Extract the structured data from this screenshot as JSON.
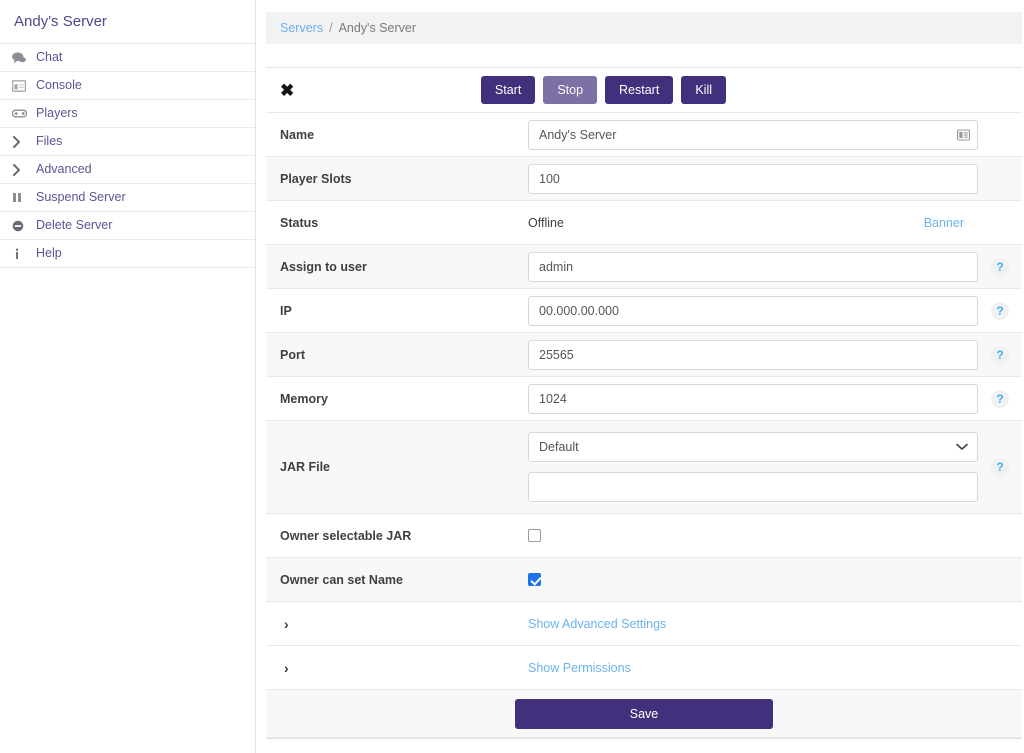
{
  "sidebar": {
    "title": "Andy's Server",
    "items": [
      {
        "label": "Chat",
        "icon": "comments-icon"
      },
      {
        "label": "Console",
        "icon": "console-window-icon"
      },
      {
        "label": "Players",
        "icon": "gamepad-icon"
      },
      {
        "label": "Files",
        "icon": "chevron-right-icon"
      },
      {
        "label": "Advanced",
        "icon": "chevron-right-icon"
      },
      {
        "label": "Suspend Server",
        "icon": "pause-icon"
      },
      {
        "label": "Delete Server",
        "icon": "minus-circle-icon"
      },
      {
        "label": "Help",
        "icon": "info-icon"
      }
    ]
  },
  "breadcrumb": {
    "root": "Servers",
    "separator": "/",
    "current": "Andy's Server"
  },
  "actions": {
    "close_glyph": "✖",
    "buttons": [
      {
        "label": "Start",
        "style": "primary"
      },
      {
        "label": "Stop",
        "style": "muted"
      },
      {
        "label": "Restart",
        "style": "primary"
      },
      {
        "label": "Kill",
        "style": "primary"
      }
    ]
  },
  "form": {
    "name": {
      "label": "Name",
      "value": "Andy's Server",
      "placeholder": "",
      "icon": "address-card-icon"
    },
    "player_slots": {
      "label": "Player Slots",
      "value": "100",
      "placeholder": ""
    },
    "status": {
      "label": "Status",
      "value": "Offline",
      "banner_link": "Banner"
    },
    "assign_user": {
      "label": "Assign to user",
      "value": "admin",
      "placeholder": "",
      "help": "?"
    },
    "ip": {
      "label": "IP",
      "value": "00.000.00.000",
      "placeholder": "",
      "help": "?"
    },
    "port": {
      "label": "Port",
      "value": "25565",
      "placeholder": "",
      "help": "?"
    },
    "memory": {
      "label": "Memory",
      "value": "1024",
      "placeholder": "",
      "help": "?"
    },
    "jar_file": {
      "label": "JAR File",
      "selected": "Default",
      "options": [
        "Default"
      ],
      "custom_value": "",
      "custom_placeholder": "",
      "help": "?"
    },
    "owner_selectable_jar": {
      "label": "Owner selectable JAR",
      "checked": false
    },
    "owner_can_set_name": {
      "label": "Owner can set Name",
      "checked": true
    }
  },
  "expanders": [
    {
      "label": "Show Advanced Settings",
      "chevron": "›"
    },
    {
      "label": "Show Permissions",
      "chevron": "›"
    }
  ],
  "footer": {
    "save_label": "Save"
  },
  "colors": {
    "primary_purple": "#42307d",
    "muted_purple": "#7d70a5",
    "link_blue": "#6cb2ee",
    "help_blue": "#41b0f4",
    "checkbox_blue": "#1a73e8",
    "sidebar_text": "#5e5395",
    "row_alt_bg": "#f8f8f8"
  }
}
